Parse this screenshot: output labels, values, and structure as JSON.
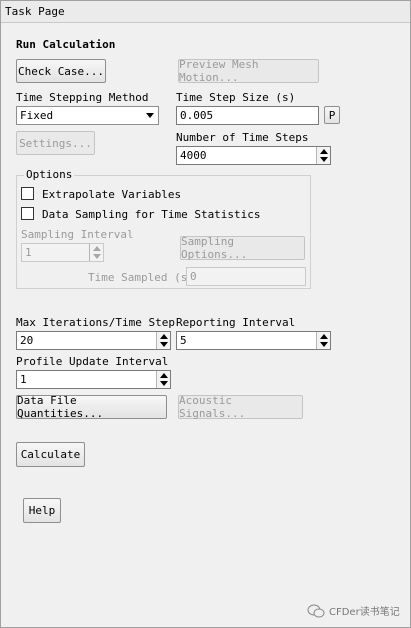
{
  "window": {
    "title": "Task Page"
  },
  "section": {
    "title": "Run Calculation"
  },
  "buttons": {
    "check_case": "Check Case...",
    "preview_mesh_motion": "Preview Mesh Motion...",
    "settings": "Settings...",
    "sampling_options": "Sampling Options...",
    "data_file_quantities": "Data File Quantities...",
    "acoustic_signals": "Acoustic Signals...",
    "calculate": "Calculate",
    "help": "Help",
    "p_button": "P"
  },
  "time_stepping": {
    "label": "Time Stepping Method",
    "value": "Fixed"
  },
  "time_step_size": {
    "label": "Time Step Size (s)",
    "value": "0.005"
  },
  "number_of_time_steps": {
    "label": "Number of Time Steps",
    "value": "4000"
  },
  "options": {
    "legend": "Options",
    "extrapolate_variables": {
      "label": "Extrapolate Variables",
      "checked": false
    },
    "data_sampling": {
      "label": "Data Sampling for Time Statistics",
      "checked": false
    },
    "sampling_interval": {
      "label": "Sampling Interval",
      "value": "1"
    },
    "time_sampled": {
      "label": "Time Sampled (s)",
      "value": "0"
    }
  },
  "max_iterations": {
    "label": "Max Iterations/Time Step",
    "value": "20"
  },
  "reporting_interval": {
    "label": "Reporting Interval",
    "value": "5"
  },
  "profile_update_interval": {
    "label": "Profile Update Interval",
    "value": "1"
  },
  "watermark": {
    "text": "CFDer读书笔记"
  }
}
